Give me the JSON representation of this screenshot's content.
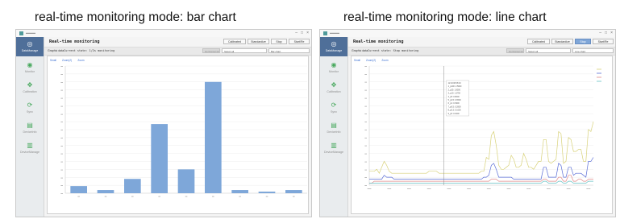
{
  "captions": {
    "left": "real-time monitoring mode: bar chart",
    "right": "real-time monitoring mode: line chart"
  },
  "colors": {
    "bar": "#7ea7d9",
    "accent_nav": "#4f6f99",
    "nav_icon": "#47a85d",
    "active_button": "#7fa6d8"
  },
  "nav_items": [
    {
      "label": "DataManage",
      "icon": "database-icon"
    },
    {
      "label": "Monitor",
      "icon": "monitor-icon"
    },
    {
      "label": "Calibration",
      "icon": "calibration-icon"
    },
    {
      "label": "Sync",
      "icon": "sync-icon"
    },
    {
      "label": "DeviceInfo",
      "icon": "device-info-icon"
    },
    {
      "label": "DeviceManage",
      "icon": "device-manage-icon"
    }
  ],
  "panel_bar": {
    "window_controls": [
      "–",
      "□",
      "×"
    ],
    "page_title": "Real-time monitoring",
    "toolbar": [
      "Calibrated",
      "Standardize",
      "Stop",
      "Start/Re"
    ],
    "graphic_data_label": "Graphic data",
    "current_state": "Current state: 1/2s monitoring",
    "controls": [
      "Horizontal window",
      "Select all",
      "Bar chart"
    ],
    "chart_links": [
      "Small",
      "Zoom(2)",
      "Zoom"
    ]
  },
  "panel_line": {
    "window_controls": [
      "–",
      "□",
      "×"
    ],
    "page_title": "Real-time monitoring",
    "toolbar": [
      "Calibrated",
      "Standardize",
      "Stop",
      "Start/Re"
    ],
    "graphic_data_label": "Graphic data",
    "current_state": "Current state: Stop monitoring",
    "controls": [
      "Horizontal window",
      "Select all",
      "Line chart"
    ],
    "chart_links": [
      "Small",
      "Zoom(2)",
      "Zoom"
    ]
  },
  "chart_data": [
    {
      "type": "bar",
      "values": [
        9,
        4,
        18,
        87,
        30,
        140,
        4,
        2,
        4
      ],
      "ylim": [
        0,
        160
      ]
    },
    {
      "type": "line",
      "series": [
        {
          "color": "#d8d27a",
          "values": [
            7,
            7,
            7,
            8,
            6,
            9,
            12,
            10,
            7,
            6,
            6,
            6,
            6,
            6,
            6,
            6,
            6,
            6,
            6,
            6,
            6,
            6,
            6,
            6,
            7,
            7,
            7,
            7,
            6,
            6,
            6,
            6,
            6,
            6,
            6,
            6,
            6,
            6,
            6,
            6,
            6,
            6,
            6,
            6,
            6,
            7,
            7,
            14,
            13,
            25,
            27,
            20,
            10,
            8,
            8,
            9,
            10,
            15,
            13,
            9,
            9,
            10,
            16,
            13,
            9,
            9,
            8,
            10,
            12,
            12,
            23,
            23,
            12,
            11,
            12,
            13,
            27,
            26,
            11,
            12,
            24,
            23,
            17,
            17,
            18,
            18,
            12,
            12,
            28,
            27,
            32
          ]
        },
        {
          "color": "#5b6ed6",
          "values": [
            3,
            3,
            3,
            3,
            3,
            3,
            5,
            4,
            4,
            4,
            3,
            3,
            3,
            3,
            3,
            3,
            3,
            3,
            3,
            3,
            3,
            3,
            3,
            3,
            3,
            3,
            3,
            3,
            3,
            3,
            3,
            3,
            3,
            3,
            3,
            3,
            3,
            3,
            3,
            3,
            3,
            3,
            3,
            3,
            3,
            3,
            4,
            4,
            5,
            10,
            11,
            8,
            4,
            4,
            4,
            4,
            4,
            4,
            3,
            3,
            3,
            3,
            3,
            3,
            3,
            3,
            3,
            3,
            3,
            3,
            9,
            9,
            4,
            4,
            4,
            4,
            11,
            10,
            4,
            4,
            9,
            9,
            5,
            6,
            6,
            6,
            5,
            4,
            12,
            12,
            14
          ]
        },
        {
          "color": "#e08b8b",
          "values": [
            1,
            1,
            2,
            2,
            2,
            2,
            2,
            2,
            2,
            2,
            2,
            2,
            2,
            2,
            2,
            2,
            2,
            2,
            2,
            2,
            2,
            2,
            2,
            2,
            2,
            2,
            2,
            2,
            2,
            2,
            2,
            2,
            2,
            2,
            2,
            2,
            2,
            2,
            2,
            2,
            2,
            2,
            2,
            2,
            2,
            2,
            2,
            2,
            2,
            3,
            3,
            3,
            2,
            2,
            2,
            2,
            2,
            2,
            2,
            2,
            2,
            2,
            2,
            2,
            2,
            2,
            2,
            2,
            2,
            2,
            3,
            3,
            2,
            2,
            2,
            2,
            4,
            4,
            2,
            2,
            5,
            5,
            2,
            2,
            3,
            3,
            2,
            2,
            3,
            3,
            3
          ]
        },
        {
          "color": "#64c0c4",
          "values": [
            1,
            1,
            1,
            1,
            1,
            1,
            1,
            1,
            1,
            1,
            1,
            1,
            1,
            1,
            1,
            1,
            1,
            1,
            1,
            1,
            1,
            1,
            1,
            1,
            1,
            1,
            1,
            1,
            1,
            1,
            1,
            1,
            1,
            1,
            1,
            1,
            1,
            1,
            1,
            1,
            1,
            1,
            1,
            1,
            1,
            1,
            1,
            1,
            1,
            1,
            1,
            1,
            1,
            1,
            1,
            1,
            1,
            1,
            1,
            1,
            1,
            1,
            1,
            1,
            1,
            1,
            1,
            1,
            1,
            1,
            2,
            2,
            1,
            1,
            1,
            1,
            2,
            2,
            1,
            1,
            2,
            2,
            1,
            1,
            1,
            1,
            1,
            1,
            2,
            2,
            2
          ]
        }
      ],
      "ylim": [
        0,
        60
      ],
      "tooltip_lines": [
        "12:24:08 08:43",
        "1_p100: 2.5000",
        "2_p25: 1.8500",
        "3_p10: 1.3750",
        "4_p5: 0.8000",
        "5_p2.5: 0.6500",
        "6_p1: 0.3900",
        "7_p0.5: 0.2800",
        "8_p0.3: 0.1600",
        "9_p0: 0.0200"
      ]
    }
  ]
}
